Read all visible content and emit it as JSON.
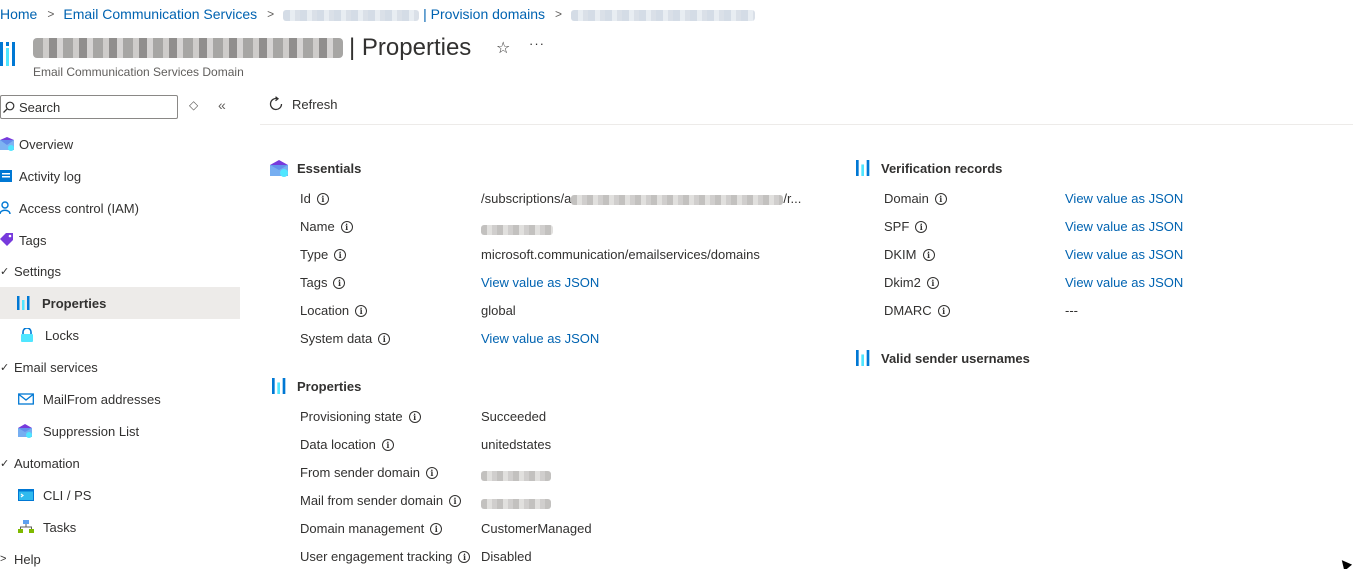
{
  "breadcrumb": {
    "home": "Home",
    "service": "Email Communication Services",
    "provision": "| Provision domains"
  },
  "header": {
    "title_suffix": "| Properties",
    "subtitle": "Email Communication Services Domain",
    "star": "☆",
    "more": "···"
  },
  "sidebar": {
    "search_placeholder": "Search",
    "items": [
      {
        "label": "Overview"
      },
      {
        "label": "Activity log"
      },
      {
        "label": "Access control (IAM)"
      },
      {
        "label": "Tags"
      },
      {
        "label": "Settings"
      },
      {
        "label": "Properties"
      },
      {
        "label": "Locks"
      },
      {
        "label": "Email services"
      },
      {
        "label": "MailFrom addresses"
      },
      {
        "label": "Suppression List"
      },
      {
        "label": "Automation"
      },
      {
        "label": "CLI / PS"
      },
      {
        "label": "Tasks"
      },
      {
        "label": "Help"
      }
    ]
  },
  "toolbar": {
    "refresh_label": "Refresh"
  },
  "essentials": {
    "title": "Essentials",
    "rows": [
      {
        "label": "Id",
        "value": "/subscriptions/a"
      },
      {
        "label": "Name",
        "value": ""
      },
      {
        "label": "Type",
        "value": "microsoft.communication/emailservices/domains"
      },
      {
        "label": "Tags",
        "value": "View value as JSON"
      },
      {
        "label": "Location",
        "value": "global"
      },
      {
        "label": "System data",
        "value": "View value as JSON"
      }
    ],
    "id_tail": "/r..."
  },
  "properties": {
    "title": "Properties",
    "rows": [
      {
        "label": "Provisioning state",
        "value": "Succeeded"
      },
      {
        "label": "Data location",
        "value": "unitedstates"
      },
      {
        "label": "From sender domain",
        "value": ""
      },
      {
        "label": "Mail from sender domain",
        "value": ""
      },
      {
        "label": "Domain management",
        "value": "CustomerManaged"
      },
      {
        "label": "User engagement tracking",
        "value": "Disabled"
      }
    ]
  },
  "verification": {
    "title": "Verification records",
    "rows": [
      {
        "label": "Domain",
        "value": "View value as JSON"
      },
      {
        "label": "SPF",
        "value": "View value as JSON"
      },
      {
        "label": "DKIM",
        "value": "View value as JSON"
      },
      {
        "label": "Dkim2",
        "value": "View value as JSON"
      },
      {
        "label": "DMARC",
        "value": "---"
      }
    ]
  },
  "valid_senders": {
    "title": "Valid sender usernames"
  },
  "colors": {
    "link": "#0063b1",
    "selected_bg": "#edebe9",
    "azure_blue": "#0078d4"
  }
}
